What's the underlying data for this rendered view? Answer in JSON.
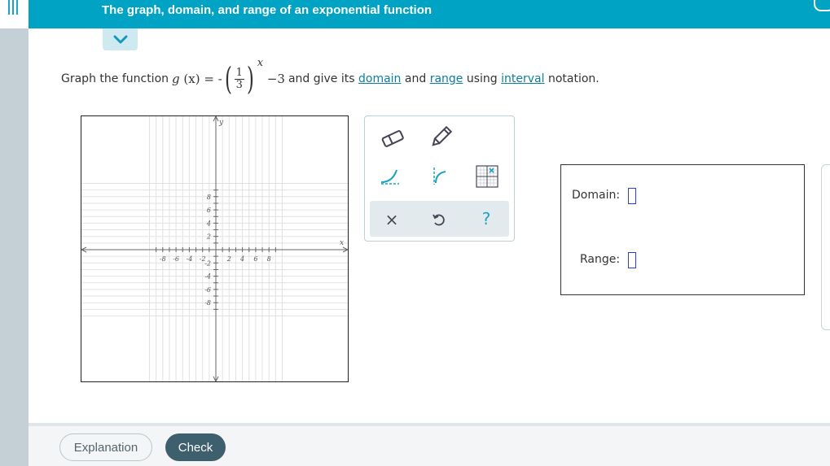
{
  "header": {
    "title": "The graph, domain, and range of an exponential function"
  },
  "problem": {
    "prefix": "Graph the function",
    "func_name": "g",
    "func_var": "(x)",
    "equals": "= -",
    "frac_num": "1",
    "frac_den": "3",
    "exponent": "x",
    "constant": "−3",
    "mid_text": "and give its",
    "link_domain": "domain",
    "and_text": "and",
    "link_range": "range",
    "using_text": "using",
    "link_interval": "interval",
    "suffix": "notation."
  },
  "graph": {
    "x_axis_label": "x",
    "y_axis_label": "y",
    "x_ticks": [
      "-8",
      "-6",
      "-4",
      "-2",
      "2",
      "4",
      "6",
      "8"
    ],
    "y_ticks": [
      "8",
      "6",
      "4",
      "2",
      "-2",
      "-4",
      "-6",
      "-8"
    ],
    "range": [
      -10,
      10
    ]
  },
  "tools": {
    "eraser": "eraser-icon",
    "pencil": "pencil-icon",
    "exp_curve": "exponential-curve-icon",
    "asymptote": "asymptote-curve-icon",
    "grid": "grid-icon",
    "clear": "×",
    "undo": "undo-icon",
    "help": "?"
  },
  "answers": {
    "domain_label": "Domain:",
    "range_label": "Range:"
  },
  "footer": {
    "explanation": "Explanation",
    "check": "Check"
  },
  "colors": {
    "accent": "#00a3c4",
    "link": "#0a7fa3",
    "check_button": "#3e5f6e"
  }
}
